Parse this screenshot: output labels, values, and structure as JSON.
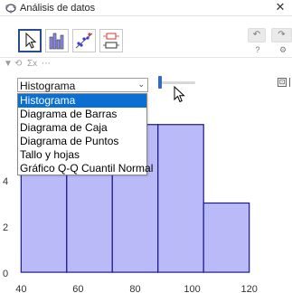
{
  "window": {
    "title": "Análisis de datos",
    "close_glyph": "✕"
  },
  "toolbar": {
    "tools": [
      {
        "name": "move",
        "icon": "pointer-arrow-icon",
        "active": true
      },
      {
        "name": "one-variable-analysis",
        "icon": "bar-chart-icon",
        "active": false
      },
      {
        "name": "two-variable-regression",
        "icon": "scatter-plot-icon",
        "active": false
      },
      {
        "name": "multi-variable-analysis",
        "icon": "multi-boxplot-icon",
        "active": false
      }
    ],
    "undo_glyph": "↶",
    "redo_glyph": "↷",
    "help_glyph": "?",
    "settings_glyph": "⚙"
  },
  "options_bar": {
    "items": [
      "▼",
      "⟲",
      "Σx",
      "⋯"
    ]
  },
  "plot_type_select": {
    "selected": "Histograma",
    "chevron": "⌄",
    "options": [
      "Histograma",
      "Diagrama de Barras",
      "Diagrama de Caja",
      "Diagrama de Puntos",
      "Tallo y hojas",
      "Gráfico Q-Q Cuantil Normal"
    ],
    "highlighted_index": 0
  },
  "panel_toggle_glyph": "⊡",
  "colors": {
    "bar_fill": "#babaf9",
    "bar_stroke": "#1a1a8a",
    "selection_blue": "#0a6fd1",
    "slider_blue": "#2d6bd0",
    "active_border": "#2a4e8b"
  },
  "chart_data": {
    "type": "bar",
    "title": "",
    "xlabel": "",
    "ylabel": "",
    "bins": [
      {
        "from": 40,
        "to": 56,
        "value": 6
      },
      {
        "from": 56,
        "to": 72,
        "value": 6.4
      },
      {
        "from": 72,
        "to": 88,
        "value": 6.4
      },
      {
        "from": 88,
        "to": 104,
        "value": 6.4
      },
      {
        "from": 104,
        "to": 120,
        "value": 3
      }
    ],
    "x_ticks": [
      40,
      60,
      80,
      100,
      120
    ],
    "y_ticks": [
      0,
      2,
      4
    ],
    "xlim": [
      32.6,
      135
    ],
    "ylim": [
      -0.35,
      7.8
    ],
    "grid": false
  }
}
